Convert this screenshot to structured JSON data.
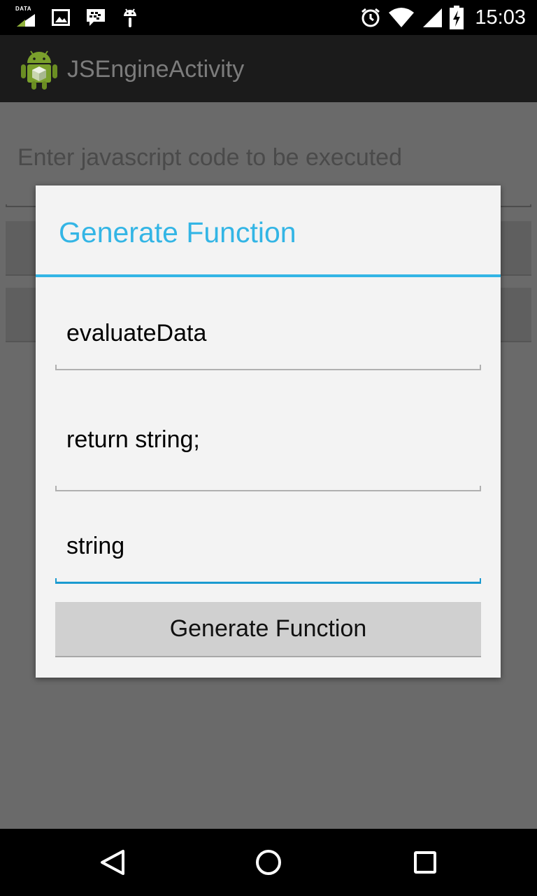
{
  "status_bar": {
    "data_label": "DATA",
    "time": "15:03",
    "icons": [
      "data-icon",
      "image-icon",
      "bbm-icon",
      "android-debug-icon",
      "alarm-icon",
      "wifi-icon",
      "cell-signal-icon",
      "battery-charging-icon"
    ]
  },
  "action_bar": {
    "title": "JSEngineActivity",
    "icon": "android-app-icon"
  },
  "background": {
    "code_hint": "Enter javascript code to be executed"
  },
  "dialog": {
    "title": "Generate Function",
    "fields": [
      {
        "value": "evaluateData"
      },
      {
        "value": "return string;"
      },
      {
        "value": "string"
      }
    ],
    "button_label": "Generate Function"
  },
  "nav_bar": {
    "icons": [
      "back-icon",
      "home-icon",
      "recents-icon"
    ]
  },
  "colors": {
    "accent": "#33b5e5",
    "focus": "#1a9ad0",
    "scrim": "#6a6a6a"
  }
}
